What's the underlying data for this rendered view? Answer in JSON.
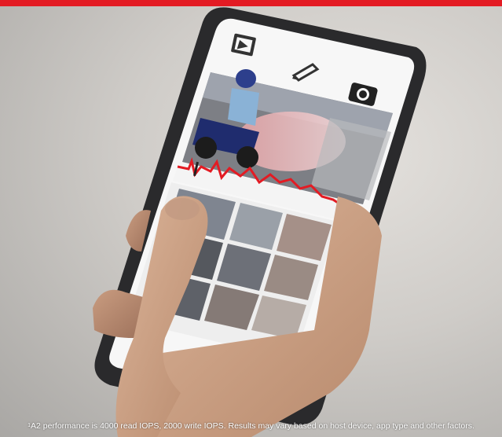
{
  "image": {
    "description_colors": {
      "accent_red": "#e31b23",
      "background": "#d6d3cf",
      "phone_body": "#2a2a2c",
      "screen_white": "#f7f7f7"
    }
  },
  "app_screen": {
    "icons": [
      "video-edit-icon",
      "pencil-icon",
      "camera-icon"
    ]
  },
  "footnote": {
    "marker": "1",
    "text": "A2 performance is 4000 read IOPS, 2000 write IOPS. Results may vary based on host device, app type and other factors."
  }
}
